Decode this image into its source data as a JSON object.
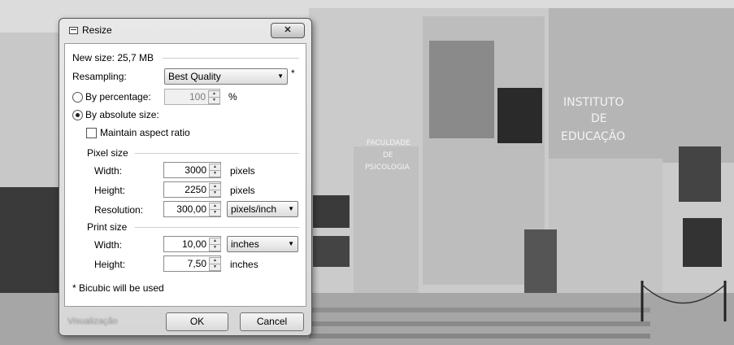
{
  "dialog": {
    "title": "Resize",
    "close_glyph": "✕",
    "blurred_text": "Visualização"
  },
  "form": {
    "new_size": "New size: 25,7 MB",
    "resampling_label": "Resampling:",
    "resampling_value": "Best Quality",
    "resampling_note": "*",
    "by_percentage_label": "By percentage:",
    "percentage_value": "100",
    "percentage_unit": "%",
    "by_absolute_label": "By absolute size:",
    "maintain_aspect_label": "Maintain aspect ratio",
    "pixel_size_heading": "Pixel size",
    "width_label": "Width:",
    "pixel_width": "3000",
    "pixel_width_unit": "pixels",
    "height_label": "Height:",
    "pixel_height": "2250",
    "pixel_height_unit": "pixels",
    "resolution_label": "Resolution:",
    "resolution_value": "300,00",
    "resolution_unit": "pixels/inch",
    "print_size_heading": "Print size",
    "print_width": "10,00",
    "print_width_unit": "inches",
    "print_height": "7,50",
    "print_height_unit": "inches",
    "footnote": "* Bicubic will be used"
  },
  "buttons": {
    "ok": "OK",
    "cancel": "Cancel"
  },
  "background": {
    "sign_institute": [
      "INSTITUTO",
      "DE",
      "EDUCAÇÃO"
    ],
    "sign_faculty": [
      "FACULDADE",
      "DE",
      "PSICOLOGIA"
    ]
  },
  "state": {
    "mode": "absolute",
    "maintain_aspect_checked": false
  }
}
